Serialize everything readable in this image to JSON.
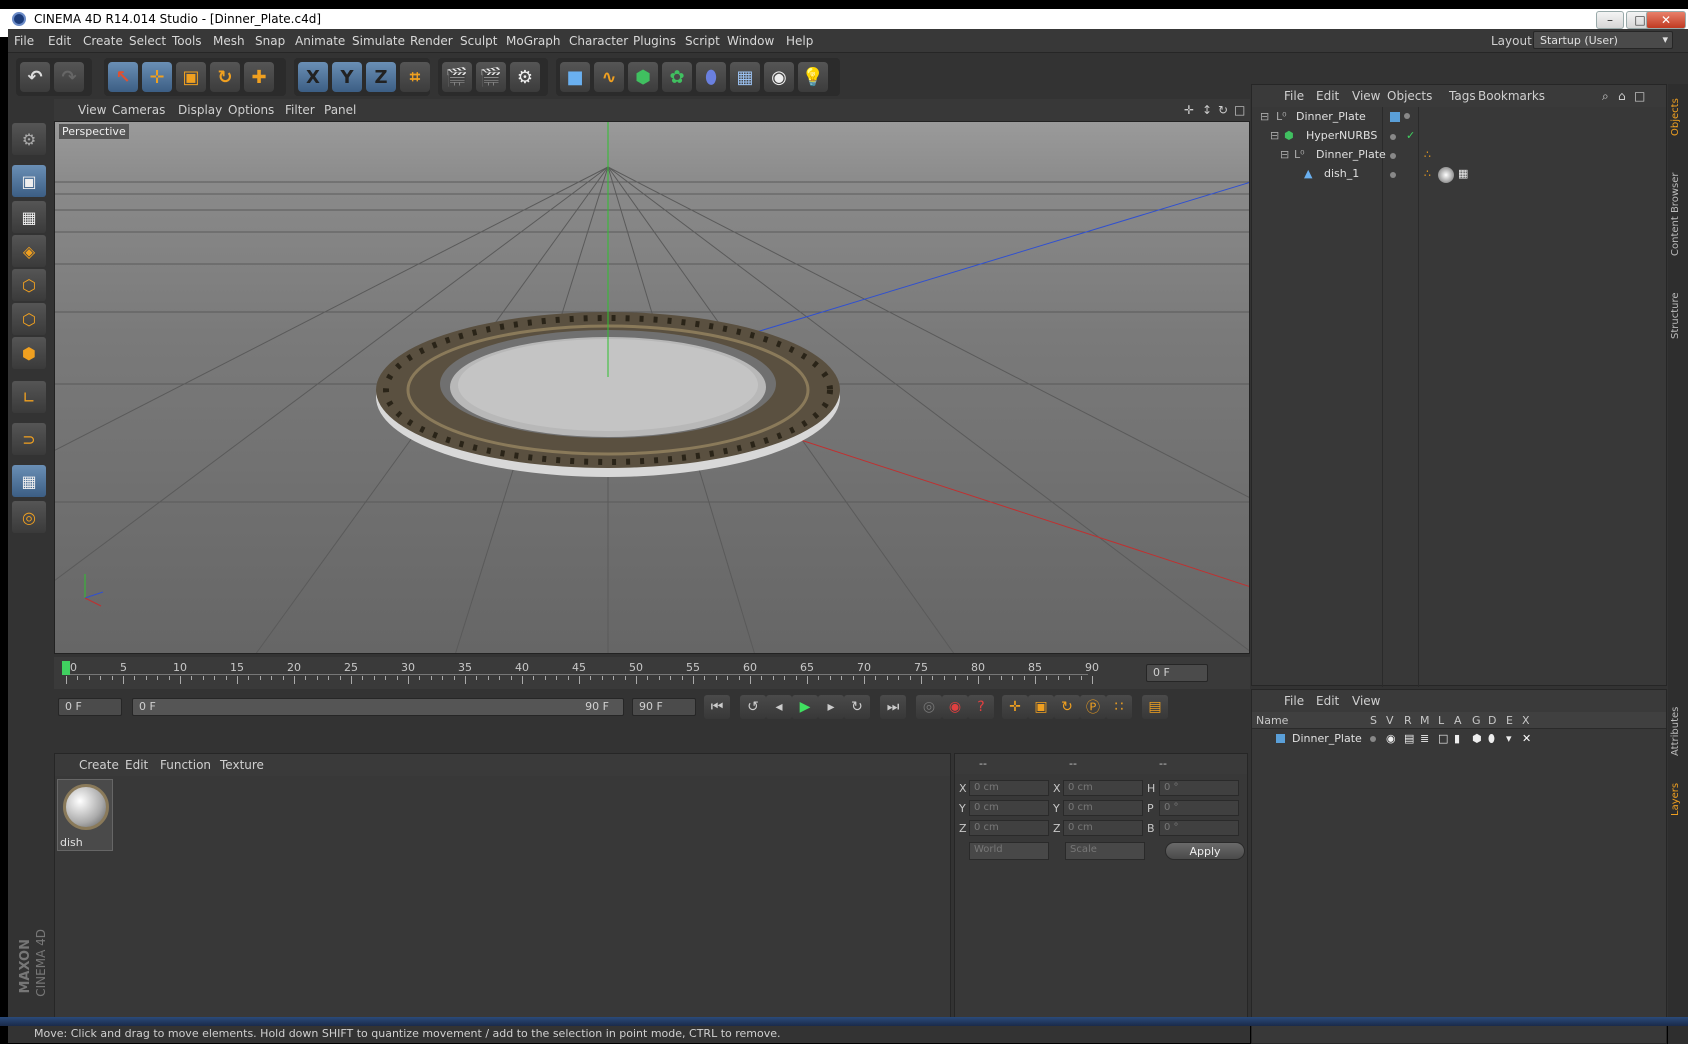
{
  "window": {
    "title": "CINEMA 4D R14.014 Studio - [Dinner_Plate.c4d]",
    "min_label": "–",
    "max_label": "□",
    "close_label": "✕"
  },
  "menubar": {
    "items": [
      "File",
      "Edit",
      "Create",
      "Select",
      "Tools",
      "Mesh",
      "Snap",
      "Animate",
      "Simulate",
      "Render",
      "Sculpt",
      "MoGraph",
      "Character",
      "Plugins",
      "Script",
      "Window",
      "Help"
    ],
    "layout_label": "Layout:",
    "layout_value": "Startup (User)"
  },
  "toolbar": {
    "axis_x": "X",
    "axis_y": "Y",
    "axis_z": "Z"
  },
  "viewport": {
    "menu": [
      "View",
      "Cameras",
      "Display",
      "Options",
      "Filter",
      "Panel"
    ],
    "label": "Perspective"
  },
  "timeline": {
    "ticks": [
      "0",
      "5",
      "10",
      "15",
      "20",
      "25",
      "30",
      "35",
      "40",
      "45",
      "50",
      "55",
      "60",
      "65",
      "70",
      "75",
      "80",
      "85",
      "90"
    ],
    "current_frame": "0 F"
  },
  "transport": {
    "start_field": "0 F",
    "range_start": "0 F",
    "range_end": "90 F",
    "end_field": "90 F"
  },
  "materials": {
    "menu": [
      "Create",
      "Edit",
      "Function",
      "Texture"
    ],
    "items": [
      {
        "name": "dish"
      }
    ]
  },
  "coordinates": {
    "headers": [
      "--",
      "--",
      "--"
    ],
    "rows": [
      {
        "a": "X",
        "av": "0 cm",
        "b": "X",
        "bv": "0 cm",
        "c": "H",
        "cv": "0 °"
      },
      {
        "a": "Y",
        "av": "0 cm",
        "b": "Y",
        "bv": "0 cm",
        "c": "P",
        "cv": "0 °"
      },
      {
        "a": "Z",
        "av": "0 cm",
        "b": "Z",
        "bv": "0 cm",
        "c": "B",
        "cv": "0 °"
      }
    ],
    "world": "World",
    "scale": "Scale",
    "apply": "Apply"
  },
  "objects": {
    "menu": [
      "File",
      "Edit",
      "View",
      "Objects",
      "Tags",
      "Bookmarks"
    ],
    "tree": [
      {
        "name": "Dinner_Plate"
      },
      {
        "name": "HyperNURBS"
      },
      {
        "name": "Dinner_Plate"
      },
      {
        "name": "dish_1"
      }
    ]
  },
  "layers": {
    "menu": [
      "File",
      "Edit",
      "View"
    ],
    "columns": [
      "Name",
      "S",
      "V",
      "R",
      "M",
      "L",
      "A",
      "G",
      "D",
      "E",
      "X"
    ],
    "rows": [
      {
        "name": "Dinner_Plate",
        "color": "#5a9fd8"
      }
    ]
  },
  "side_tabs": [
    "Objects",
    "Content Browser",
    "Structure",
    "Attributes",
    "Layers"
  ],
  "status": "Move: Click and drag to move elements. Hold down SHIFT to quantize movement / add to the selection in point mode, CTRL to remove.",
  "brand": {
    "maxon": "MAXON",
    "product": "CINEMA 4D"
  },
  "colors": {
    "accent": "#5a8ac0",
    "x_axis": "#c03030",
    "y_axis": "#30c030",
    "z_axis": "#3050d0"
  }
}
